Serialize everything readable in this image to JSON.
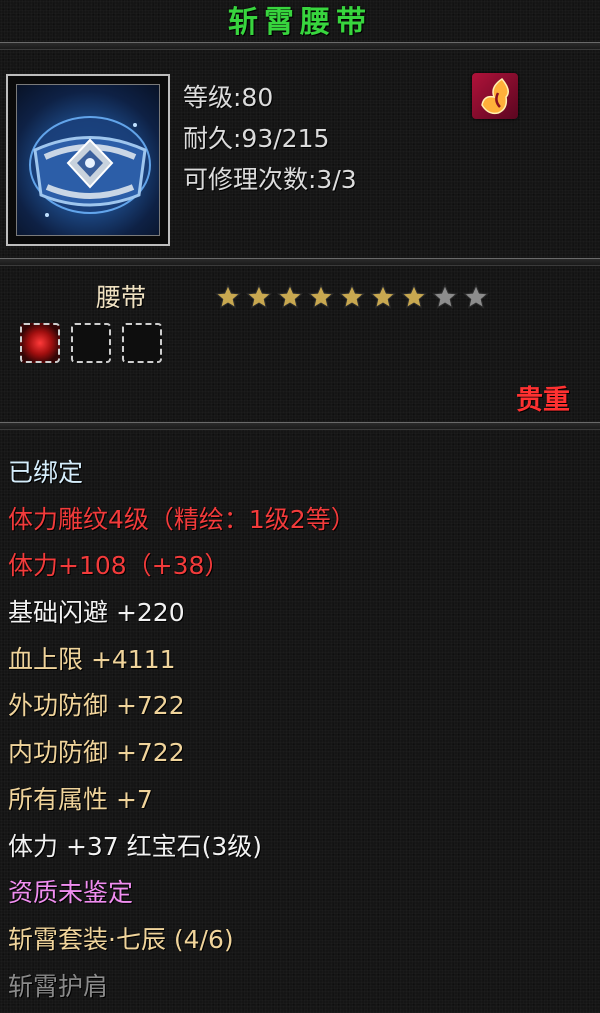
{
  "item": {
    "name": "斩霄腰带",
    "icon": "belt-item-icon",
    "badge_icon": "flame-crest-icon",
    "level": "等级:80",
    "durability": "耐久:93/215",
    "repair": "可修理次数:3/3",
    "type": "腰带",
    "stars": {
      "filled": 7,
      "total": 9
    },
    "sockets": [
      {
        "gem": "red-gem-icon",
        "filled": true
      },
      {
        "filled": false
      },
      {
        "filled": false
      }
    ],
    "rarity": "贵重"
  },
  "attributes": [
    {
      "text": "已绑定",
      "color": "#d6eefc"
    },
    {
      "text": "体力雕纹4级（精绘：1级2等）",
      "color": "#f23b3b"
    },
    {
      "text": "体力+108（+38）",
      "color": "#f23b3b"
    },
    {
      "text": "基础闪避 +220",
      "color": "#f2f2f2"
    },
    {
      "text": "血上限 +4111",
      "color": "#f0d49b"
    },
    {
      "text": "外功防御 +722",
      "color": "#f0d49b"
    },
    {
      "text": "内功防御 +722",
      "color": "#f0d49b"
    },
    {
      "text": "所有属性 +7",
      "color": "#f0d49b"
    },
    {
      "text": "体力 +37 红宝石(3级)",
      "color": "#f2f2f2"
    },
    {
      "text": "资质未鉴定",
      "color": "#f08ef0"
    },
    {
      "text": "斩霄套装·七辰 (4/6)",
      "color": "#f0d49b"
    },
    {
      "text": "斩霄护肩",
      "color": "#8a8a8a"
    }
  ],
  "colors": {
    "title": "#38d53e",
    "rarity": "#ff3131",
    "star_on": "#c8a850",
    "star_off": "#8c8c8c"
  }
}
